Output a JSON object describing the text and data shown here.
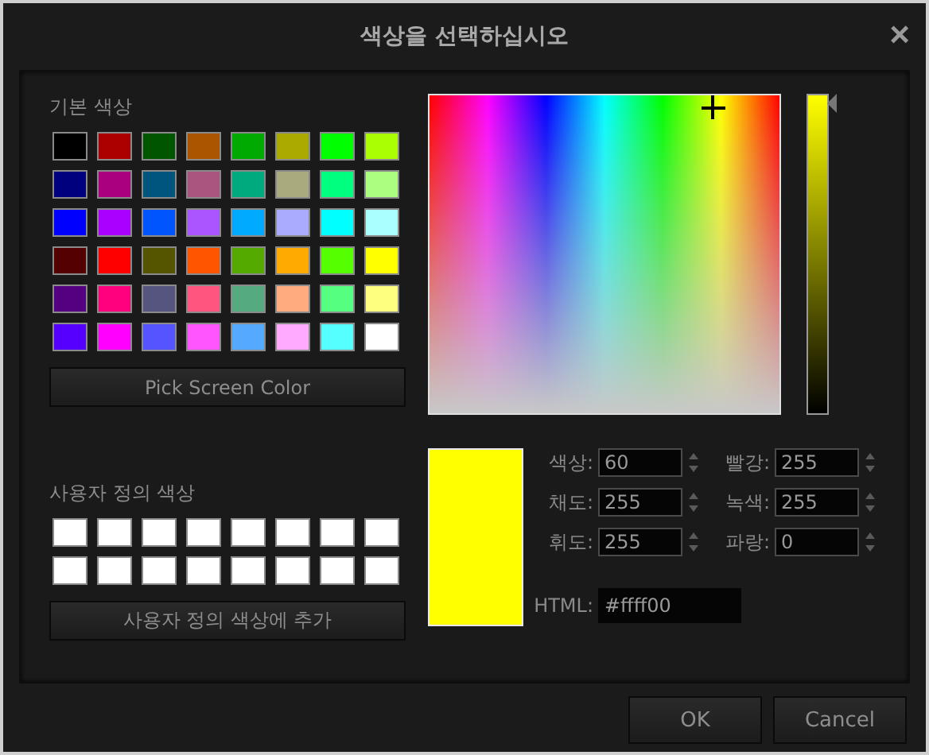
{
  "window": {
    "title": "색상을 선택하십시오",
    "close": "×"
  },
  "basic_colors": {
    "label": "기본 색상",
    "swatches": [
      {
        "color": "#000000"
      },
      {
        "color": "#aa0000"
      },
      {
        "color": "#005500"
      },
      {
        "color": "#aa5500"
      },
      {
        "color": "#00aa00"
      },
      {
        "color": "#aaaa00"
      },
      {
        "color": "#00ff00"
      },
      {
        "color": "#aaff00"
      },
      {
        "color": "#00007f"
      },
      {
        "color": "#aa007f"
      },
      {
        "color": "#00557f"
      },
      {
        "color": "#aa557f"
      },
      {
        "color": "#00aa7f"
      },
      {
        "color": "#aaaa7f"
      },
      {
        "color": "#00ff7f"
      },
      {
        "color": "#aaff7f"
      },
      {
        "color": "#0000ff"
      },
      {
        "color": "#aa00ff"
      },
      {
        "color": "#0055ff"
      },
      {
        "color": "#aa55ff"
      },
      {
        "color": "#00aaff"
      },
      {
        "color": "#aaaaff"
      },
      {
        "color": "#00ffff"
      },
      {
        "color": "#aaffff"
      },
      {
        "color": "#550000"
      },
      {
        "color": "#ff0000"
      },
      {
        "color": "#555500"
      },
      {
        "color": "#ff5500"
      },
      {
        "color": "#55aa00"
      },
      {
        "color": "#ffaa00"
      },
      {
        "color": "#55ff00"
      },
      {
        "color": "#ffff00"
      },
      {
        "color": "#55007f"
      },
      {
        "color": "#ff007f"
      },
      {
        "color": "#55557f"
      },
      {
        "color": "#ff557f"
      },
      {
        "color": "#55aa7f"
      },
      {
        "color": "#ffaa7f"
      },
      {
        "color": "#55ff7f"
      },
      {
        "color": "#ffff7f"
      },
      {
        "color": "#5500ff"
      },
      {
        "color": "#ff00ff"
      },
      {
        "color": "#5555ff"
      },
      {
        "color": "#ff55ff"
      },
      {
        "color": "#55aaff"
      },
      {
        "color": "#ffaaff"
      },
      {
        "color": "#55ffff"
      },
      {
        "color": "#ffffff"
      }
    ],
    "button": "Pick Screen Color"
  },
  "custom_colors": {
    "label": "사용자 정의 색상",
    "swatches": [
      {
        "color": "#ffffff"
      },
      {
        "color": "#ffffff"
      },
      {
        "color": "#ffffff"
      },
      {
        "color": "#ffffff"
      },
      {
        "color": "#ffffff"
      },
      {
        "color": "#ffffff"
      },
      {
        "color": "#ffffff"
      },
      {
        "color": "#ffffff"
      },
      {
        "color": "#ffffff"
      },
      {
        "color": "#ffffff"
      },
      {
        "color": "#ffffff"
      },
      {
        "color": "#ffffff"
      },
      {
        "color": "#ffffff"
      },
      {
        "color": "#ffffff"
      },
      {
        "color": "#ffffff"
      },
      {
        "color": "#ffffff"
      }
    ],
    "button": "사용자 정의 색상에 추가"
  },
  "value_slider": {
    "level": 1
  },
  "preview": {
    "color": "#ffff00"
  },
  "fields": [
    {
      "label": "색상:",
      "value": "60"
    },
    {
      "label": "빨강:",
      "value": "255"
    },
    {
      "label": "채도:",
      "value": "255"
    },
    {
      "label": "녹색:",
      "value": "255"
    },
    {
      "label": "휘도:",
      "value": "255"
    },
    {
      "label": "파랑:",
      "value": "0"
    }
  ],
  "html": {
    "label": "HTML:",
    "value": "#ffff00"
  },
  "buttons": [
    "OK",
    "Cancel"
  ]
}
